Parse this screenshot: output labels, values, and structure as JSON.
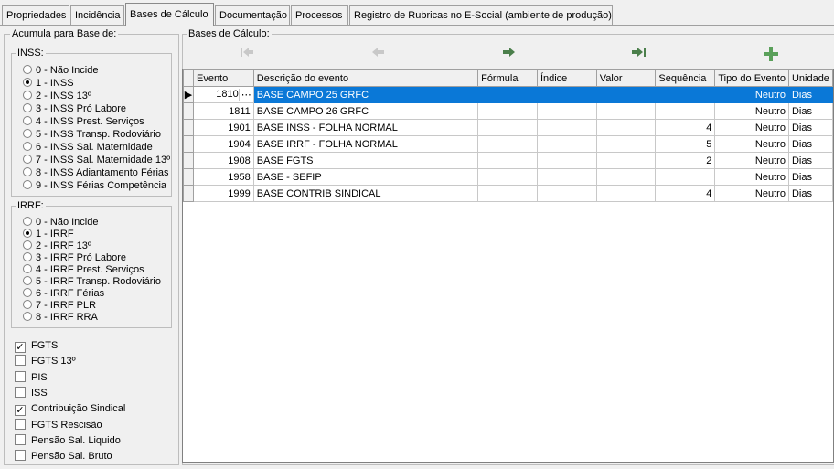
{
  "tabs": [
    "Propriedades",
    "Incidência",
    "Bases de Cálculo",
    "Documentação",
    "Processos",
    "Registro de Rubricas no E-Social (ambiente de produção)"
  ],
  "left": {
    "title": "Acumula para Base de:",
    "inss": {
      "title": "INSS:",
      "options": [
        "0 - Não Incide",
        "1 - INSS",
        "2 - INSS 13º",
        "3 - INSS Pró Labore",
        "4 - INSS Prest. Serviços",
        "5 - INSS Transp. Rodoviário",
        "6 - INSS Sal. Maternidade",
        "7 - INSS Sal. Maternidade 13º",
        "8 - INSS Adiantamento Férias",
        "9 - INSS Férias Competência"
      ],
      "selected": 1
    },
    "irrf": {
      "title": "IRRF:",
      "options": [
        "0 - Não Incide",
        "1 - IRRF",
        "2 - IRRF 13º",
        "3 - IRRF Pró Labore",
        "4 - IRRF Prest. Serviços",
        "5 - IRRF Transp. Rodoviário",
        "6 - IRRF Férias",
        "7 - IRRF PLR",
        "8 - IRRF RRA"
      ],
      "selected": 1
    },
    "checks": [
      {
        "label": "FGTS",
        "checked": true
      },
      {
        "label": "FGTS 13º",
        "checked": false
      },
      {
        "label": "PIS",
        "checked": false
      },
      {
        "label": "ISS",
        "checked": false
      },
      {
        "label": "Contribuição Sindical",
        "checked": true
      },
      {
        "label": "FGTS Rescisão",
        "checked": false
      },
      {
        "label": "Pensão Sal. Liquido",
        "checked": false
      },
      {
        "label": "Pensão Sal. Bruto",
        "checked": false
      }
    ]
  },
  "right": {
    "title": "Bases de Cálculo:",
    "toolbar": {
      "first_icon": "first-record-icon",
      "prev_icon": "previous-record-icon",
      "next_icon": "next-record-icon",
      "last_icon": "last-record-icon",
      "add_icon": "add-record-icon"
    },
    "columns": [
      "Evento",
      "Descrição do evento",
      "Fórmula",
      "Índice",
      "Valor",
      "Sequência",
      "Tipo do Evento",
      "Unidade"
    ],
    "rows": [
      {
        "evento": "1810",
        "descricao": "BASE CAMPO 25 GRFC",
        "formula": "",
        "indice": "",
        "valor": "",
        "sequencia": "",
        "tipo": "Neutro",
        "unidade": "Dias"
      },
      {
        "evento": "1811",
        "descricao": "BASE CAMPO 26 GRFC",
        "formula": "",
        "indice": "",
        "valor": "",
        "sequencia": "",
        "tipo": "Neutro",
        "unidade": "Dias"
      },
      {
        "evento": "1901",
        "descricao": "BASE INSS - FOLHA NORMAL",
        "formula": "",
        "indice": "",
        "valor": "",
        "sequencia": "4",
        "tipo": "Neutro",
        "unidade": "Dias"
      },
      {
        "evento": "1904",
        "descricao": "BASE IRRF - FOLHA NORMAL",
        "formula": "",
        "indice": "",
        "valor": "",
        "sequencia": "5",
        "tipo": "Neutro",
        "unidade": "Dias"
      },
      {
        "evento": "1908",
        "descricao": "BASE FGTS",
        "formula": "",
        "indice": "",
        "valor": "",
        "sequencia": "2",
        "tipo": "Neutro",
        "unidade": "Dias"
      },
      {
        "evento": "1958",
        "descricao": "BASE - SEFIP",
        "formula": "",
        "indice": "",
        "valor": "",
        "sequencia": "",
        "tipo": "Neutro",
        "unidade": "Dias"
      },
      {
        "evento": "1999",
        "descricao": "BASE CONTRIB SINDICAL",
        "formula": "",
        "indice": "",
        "valor": "",
        "sequencia": "4",
        "tipo": "Neutro",
        "unidade": "Dias"
      }
    ],
    "selected_row": 0
  },
  "colors": {
    "selection": "#0a78d7",
    "nav_disabled": "#c0c0c0",
    "nav_enabled": "#4b7f4b",
    "add": "#5aa05a"
  }
}
